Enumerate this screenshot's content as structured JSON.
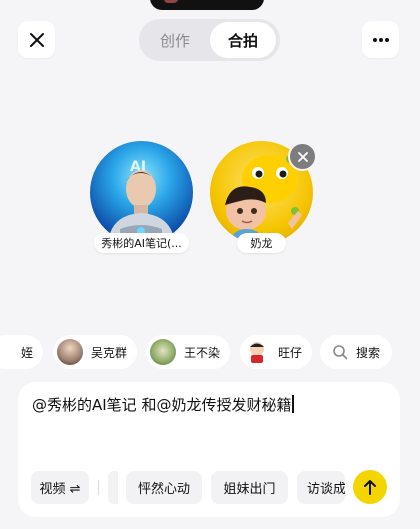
{
  "header": {
    "tabs": [
      {
        "label": "创作",
        "active": false
      },
      {
        "label": "合拍",
        "active": true
      }
    ],
    "close_icon": "close-icon",
    "more_icon": "more-horizontal-icon"
  },
  "participants": [
    {
      "name": "秀彬的AI笔记(...",
      "avatar": "robot-avatar"
    },
    {
      "name": "奶龙",
      "avatar": "yellow-dragon-avatar",
      "removable": true
    }
  ],
  "suggestions": [
    {
      "label": "姪"
    },
    {
      "label": "吴克群"
    },
    {
      "label": "王不染"
    },
    {
      "label": "旺仔"
    },
    {
      "label": "搜索",
      "icon": "search-icon"
    }
  ],
  "composer": {
    "text": "@秀彬的AI笔记 和@奶龙传授发财秘籍",
    "tools": [
      {
        "label": "视频 ⇌"
      },
      {
        "label": "怦然心动"
      },
      {
        "label": "姐妹出门"
      },
      {
        "label": "访谈成"
      }
    ],
    "send_icon": "arrow-up-icon"
  },
  "colors": {
    "accent": "#f5d500",
    "background": "#f5f5f7"
  }
}
